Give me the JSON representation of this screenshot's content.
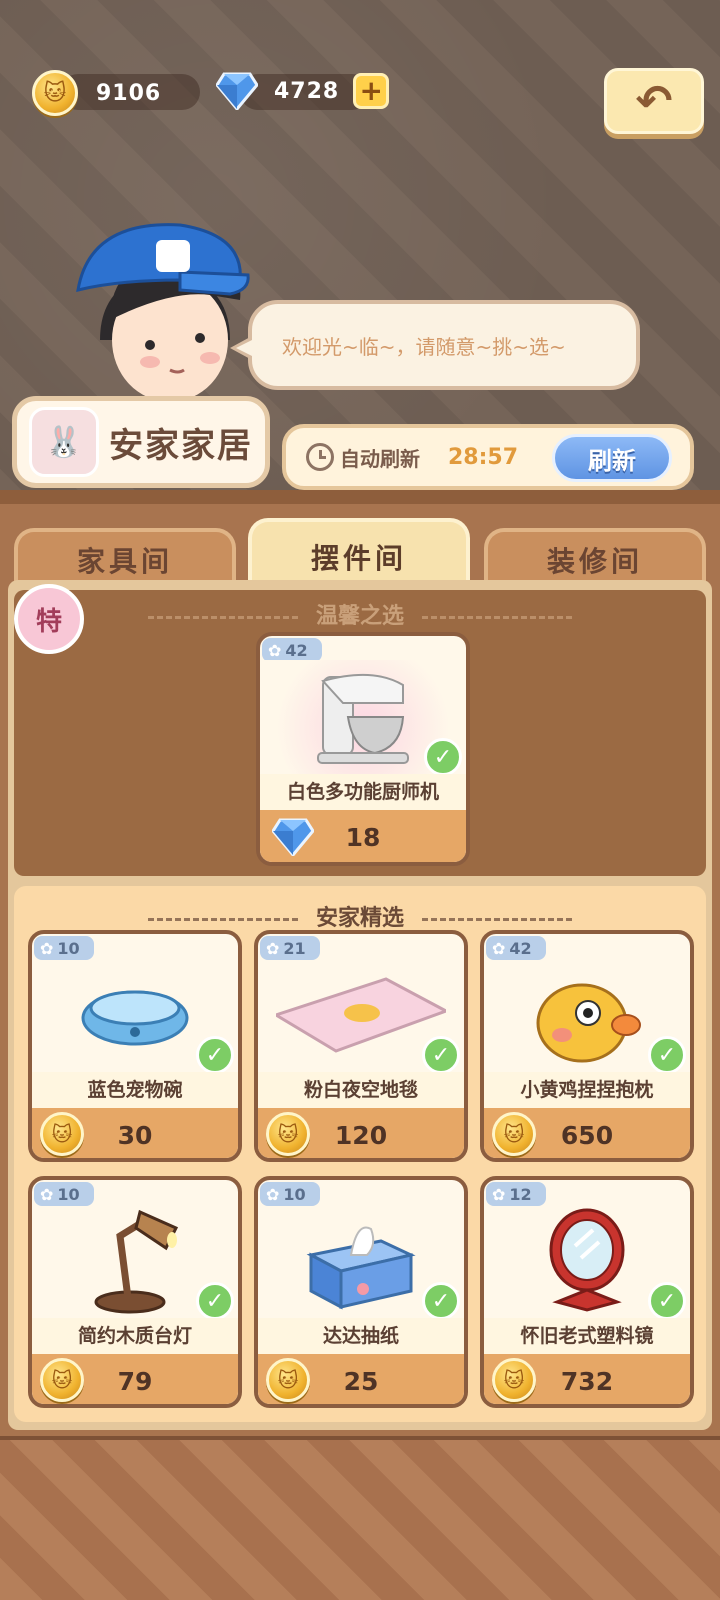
{
  "currency": {
    "coins": "9106",
    "gems": "4728"
  },
  "npc": {
    "greeting": "欢迎光~临~，请随意~挑~选~"
  },
  "shop": {
    "name": "安家家居",
    "logo_glyph": "🐰"
  },
  "refresh": {
    "auto_label": "自动刷新",
    "timer": "28:57",
    "button_label": "刷新"
  },
  "tabs": [
    {
      "label": "家具间",
      "active": false
    },
    {
      "label": "摆件间",
      "active": true
    },
    {
      "label": "装修间",
      "active": false
    }
  ],
  "special": {
    "badge": "特",
    "section_title": "温馨之选",
    "item": {
      "level": "42",
      "name": "白色多功能厨师机",
      "price": "18",
      "currency": "gem",
      "owned": true
    }
  },
  "selection": {
    "section_title": "安家精选",
    "items": [
      {
        "level": "10",
        "name": "蓝色宠物碗",
        "price": "30",
        "currency": "coin",
        "owned": true,
        "icon": "pet-bowl-icon"
      },
      {
        "level": "21",
        "name": "粉白夜空地毯",
        "price": "120",
        "currency": "coin",
        "owned": true,
        "icon": "rug-icon"
      },
      {
        "level": "42",
        "name": "小黄鸡捏捏抱枕",
        "price": "650",
        "currency": "coin",
        "owned": true,
        "icon": "chick-pillow-icon"
      },
      {
        "level": "10",
        "name": "简约木质台灯",
        "price": "79",
        "currency": "coin",
        "owned": true,
        "icon": "desk-lamp-icon"
      },
      {
        "level": "10",
        "name": "达达抽纸",
        "price": "25",
        "currency": "coin",
        "owned": true,
        "icon": "tissue-box-icon"
      },
      {
        "level": "12",
        "name": "怀旧老式塑料镜",
        "price": "732",
        "currency": "coin",
        "owned": true,
        "icon": "mirror-icon"
      }
    ]
  },
  "colors": {
    "accent_gold": "#f0b22e",
    "owned_green": "#7dcd65",
    "refresh_blue": "#5f94e3"
  }
}
